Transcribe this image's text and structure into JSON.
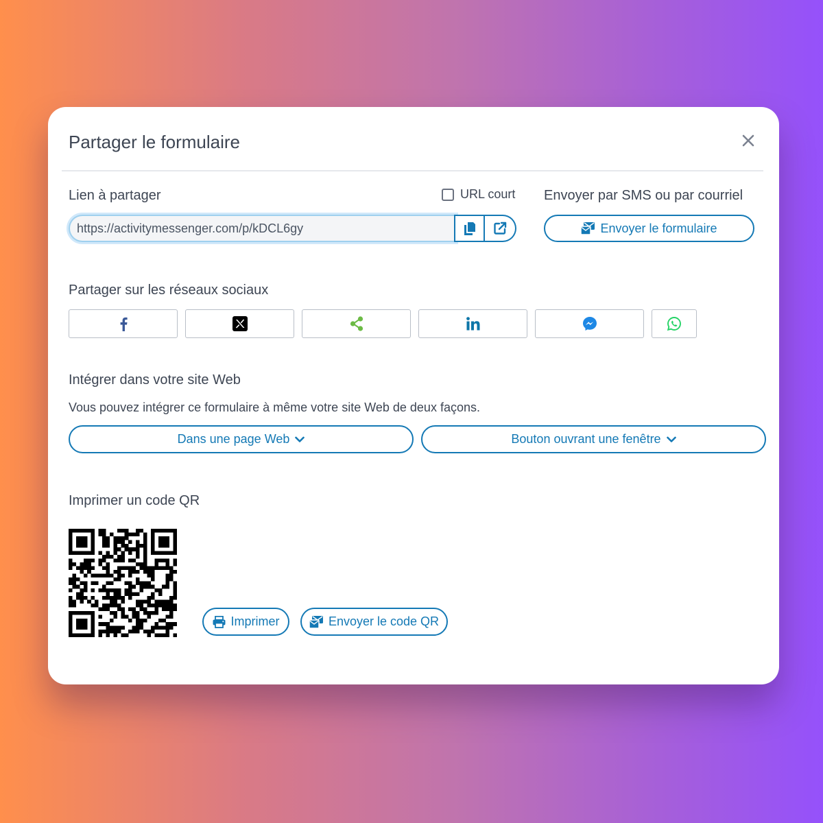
{
  "modal": {
    "title": "Partager le formulaire"
  },
  "link": {
    "label": "Lien à partager",
    "short_url_label": "URL court",
    "short_url_checked": false,
    "url_value": "https://activitymessenger.com/p/kDCL6gy"
  },
  "send": {
    "label": "Envoyer par SMS ou par courriel",
    "button_label": "Envoyer le formulaire"
  },
  "social": {
    "label": "Partager sur les réseaux sociaux",
    "buttons": [
      {
        "network": "facebook",
        "icon": "facebook-icon",
        "color": "#3b5998"
      },
      {
        "network": "x",
        "icon": "x-icon",
        "color": "#000000"
      },
      {
        "network": "share",
        "icon": "share-icon",
        "color": "#6cbb45"
      },
      {
        "network": "linkedin",
        "icon": "linkedin-icon",
        "color": "#0e76a8"
      },
      {
        "network": "messenger",
        "icon": "messenger-icon",
        "color": "#1e88e5"
      },
      {
        "network": "whatsapp",
        "icon": "whatsapp-icon",
        "color": "#25d366"
      }
    ]
  },
  "embed": {
    "label": "Intégrer dans votre site Web",
    "description": "Vous pouvez intégrer ce formulaire à même votre site Web de deux façons.",
    "page_button": "Dans une page Web",
    "popup_button": "Bouton ouvrant une fenêtre"
  },
  "qr": {
    "label": "Imprimer un code QR",
    "print_button": "Imprimer",
    "send_button": "Envoyer le code QR"
  },
  "colors": {
    "accent": "#1479b5",
    "text": "#3d4553"
  }
}
